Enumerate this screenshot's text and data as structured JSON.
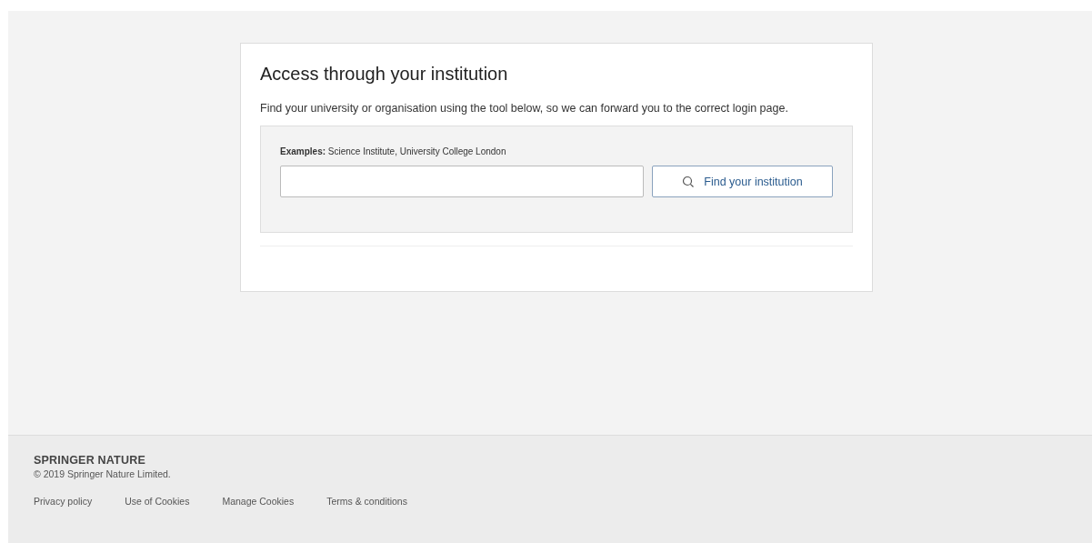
{
  "card": {
    "title": "Access through your institution",
    "intro": "Find your university or organisation using the tool below, so we can forward you to the correct login page.",
    "search": {
      "hint": "**Examples:** Science Institute, University College London",
      "button": "Find your institution"
    }
  },
  "footer": {
    "logo": "SPRINGER NATURE",
    "copyright": "© 2019 Springer Nature Limited.",
    "links": [
      "Privacy policy",
      "Use of Cookies",
      "Manage Cookies",
      "Terms & conditions"
    ]
  }
}
